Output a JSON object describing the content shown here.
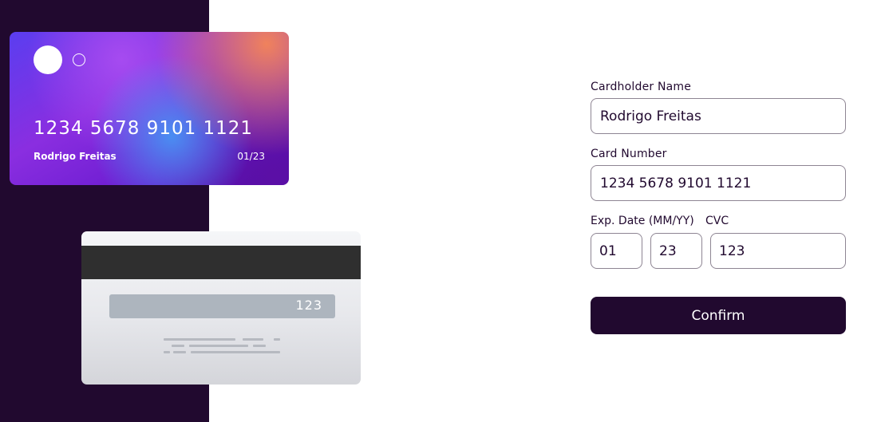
{
  "card_front": {
    "number": "1234 5678 9101 1121",
    "name": "Rodrigo Freitas",
    "expiry": "01/23"
  },
  "card_back": {
    "cvc": "123"
  },
  "form": {
    "cardholder_label": "Cardholder Name",
    "cardholder_value": "Rodrigo Freitas",
    "number_label": "Card Number",
    "number_value": "1234 5678 9101 1121",
    "exp_label": "Exp. Date (MM/YY)",
    "exp_month_value": "01",
    "exp_year_value": "23",
    "cvc_label": "CVC",
    "cvc_value": "123",
    "confirm_label": "Confirm"
  },
  "colors": {
    "panel_dark": "#21092f",
    "input_border": "#8e8593",
    "button_bg": "#21092f"
  }
}
